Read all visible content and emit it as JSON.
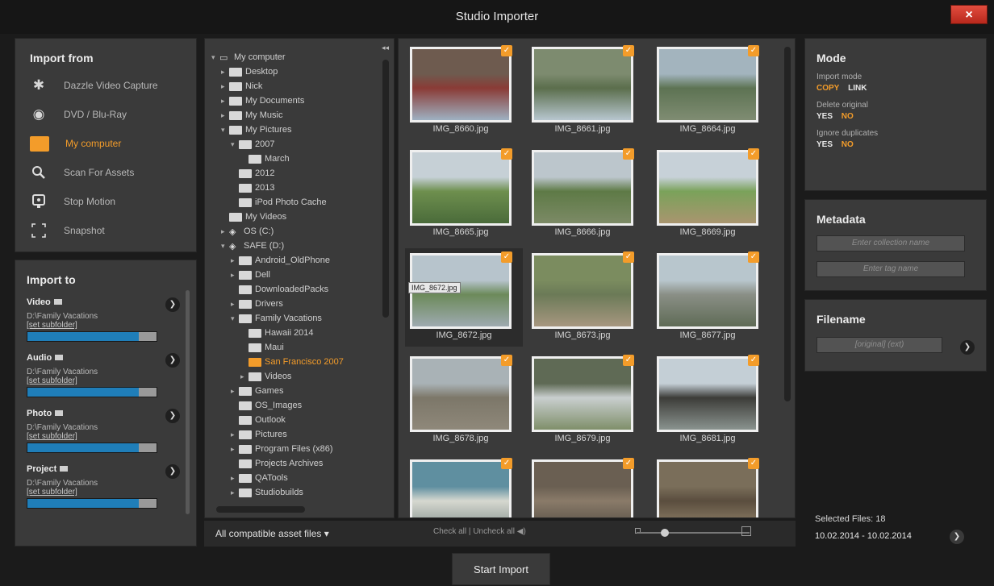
{
  "window": {
    "title": "Studio Importer",
    "close_label": "×"
  },
  "import_from": {
    "title": "Import from",
    "items": [
      {
        "label": "Dazzle Video Capture",
        "icon": "gear-icon"
      },
      {
        "label": "DVD / Blu-Ray",
        "icon": "disc-icon"
      },
      {
        "label": "My computer",
        "icon": "folder-icon"
      },
      {
        "label": "Scan For Assets",
        "icon": "magnifier-icon"
      },
      {
        "label": "Stop Motion",
        "icon": "webcam-icon"
      },
      {
        "label": "Snapshot",
        "icon": "snapshot-frame-icon"
      }
    ]
  },
  "import_to": {
    "title": "Import to",
    "items": [
      {
        "label": "Video",
        "path": "D:\\Family Vacations",
        "sub": "[set subfolder]"
      },
      {
        "label": "Audio",
        "path": "D:\\Family Vacations",
        "sub": "[set subfolder]"
      },
      {
        "label": "Photo",
        "path": "D:\\Family Vacations",
        "sub": "[set subfolder]"
      },
      {
        "label": "Project",
        "path": "D:\\Family Vacations",
        "sub": "[set subfolder]"
      }
    ]
  },
  "tree": [
    {
      "label": "My computer"
    },
    {
      "label": "Desktop"
    },
    {
      "label": "Nick"
    },
    {
      "label": "My Documents"
    },
    {
      "label": "My Music"
    },
    {
      "label": "My Pictures"
    },
    {
      "label": "2007"
    },
    {
      "label": "March"
    },
    {
      "label": "2012"
    },
    {
      "label": "2013"
    },
    {
      "label": "iPod Photo Cache"
    },
    {
      "label": "My Videos"
    },
    {
      "label": "OS (C:)"
    },
    {
      "label": "SAFE (D:)"
    },
    {
      "label": "Android_OldPhone"
    },
    {
      "label": "Dell"
    },
    {
      "label": "DownloadedPacks"
    },
    {
      "label": "Drivers"
    },
    {
      "label": "Family Vacations"
    },
    {
      "label": "Hawaii 2014"
    },
    {
      "label": "Maui"
    },
    {
      "label": "San Francisco 2007"
    },
    {
      "label": "Videos"
    },
    {
      "label": "Games"
    },
    {
      "label": "OS_Images"
    },
    {
      "label": "Outlook"
    },
    {
      "label": "Pictures"
    },
    {
      "label": "Program Files (x86)"
    },
    {
      "label": "Projects Archives"
    },
    {
      "label": "QATools"
    },
    {
      "label": "Studiobuilds"
    }
  ],
  "photos": [
    "IMG_8660.jpg",
    "IMG_8661.jpg",
    "IMG_8664.jpg",
    "IMG_8665.jpg",
    "IMG_8666.jpg",
    "IMG_8669.jpg",
    "IMG_8672.jpg",
    "IMG_8673.jpg",
    "IMG_8677.jpg",
    "IMG_8678.jpg",
    "IMG_8679.jpg",
    "IMG_8681.jpg",
    "",
    "",
    ""
  ],
  "tooltip": "IMG_8672.jpg",
  "bottom": {
    "filter": "All compatible asset files ▾",
    "check_all": "Check all",
    "separator": "|",
    "uncheck_all": "Uncheck all"
  },
  "mode": {
    "title": "Mode",
    "import_mode_label": "Import mode",
    "copy": "COPY",
    "link": "LINK",
    "delete_label": "Delete original",
    "ignore_label": "Ignore duplicates",
    "yes": "YES",
    "no": "NO"
  },
  "metadata": {
    "title": "Metadata",
    "collection_placeholder": "Enter collection name",
    "tag_placeholder": "Enter tag name"
  },
  "filename": {
    "title": "Filename",
    "value": "[original] (ext)"
  },
  "selected_files": "Selected Files: 18",
  "date_range": "10.02.2014 - 10.02.2014",
  "start_import": "Start Import",
  "colors": {
    "accent": "#f39c2a",
    "panel": "#3a3a3a",
    "background": "#1b1b1b",
    "progress": "#1f7eb9"
  }
}
